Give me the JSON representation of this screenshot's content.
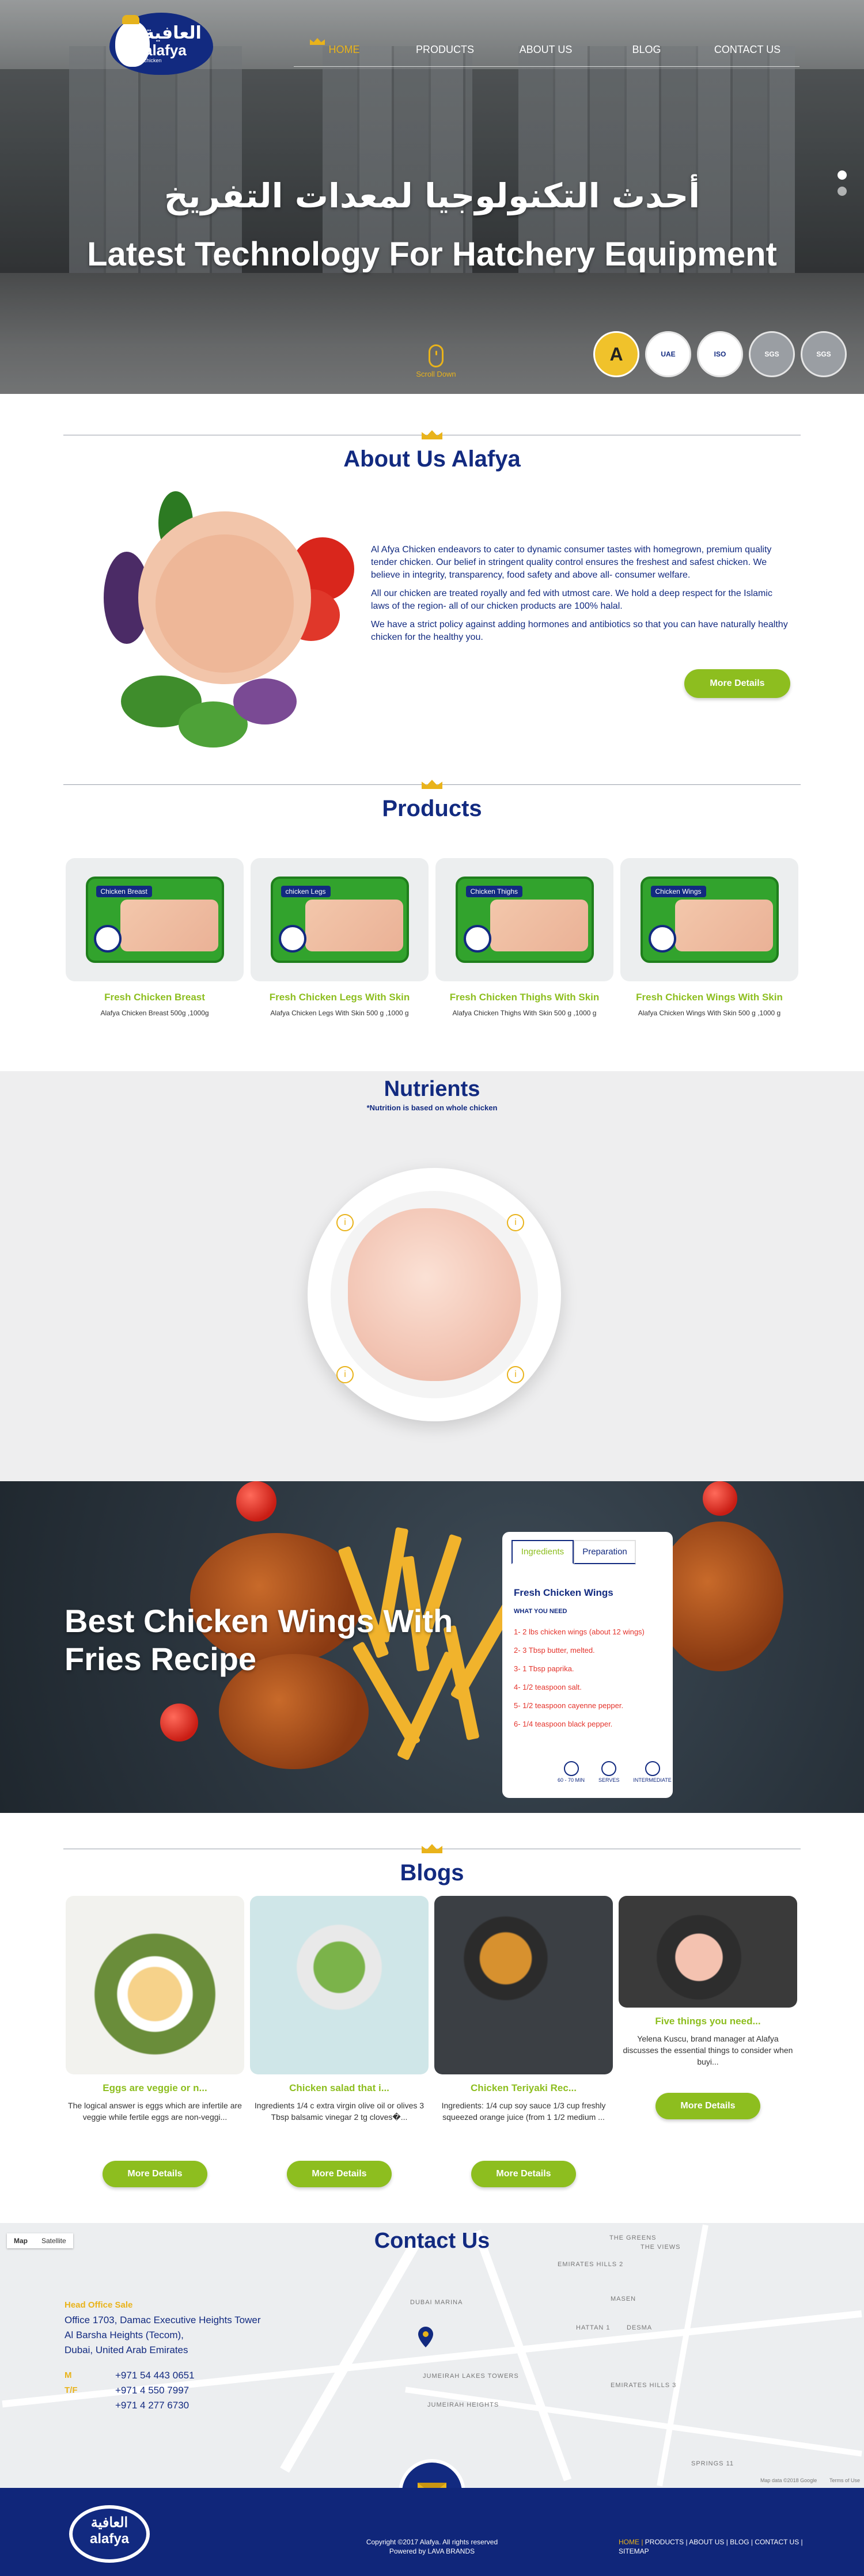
{
  "brand": {
    "arabic": "العافية",
    "name": "alafya",
    "sub": "chicken"
  },
  "nav": {
    "items": [
      "HOME",
      "PRODUCTS",
      "ABOUT US",
      "BLOG",
      "CONTACT US"
    ]
  },
  "hero": {
    "title_ar": "أحدث التكنولوجيا لمعدات التفريخ",
    "title_en": "Latest Technology For Hatchery Equipment",
    "scroll_label": "Scroll Down",
    "badges": [
      "A",
      "UAE",
      "ISO",
      "SGS",
      "SGS"
    ]
  },
  "about": {
    "heading": "About Us Alafya",
    "p1": "Al Afya Chicken endeavors to cater to dynamic consumer tastes with homegrown, premium quality tender chicken. Our belief in stringent quality control ensures the freshest and safest chicken. We believe in integrity, transparency, food safety and above all- consumer welfare.",
    "p2": "All our chicken are treated royally and fed with utmost care. We hold a deep respect for the Islamic laws of the region- all of our chicken products are 100% halal.",
    "p3": "We have a strict policy against adding hormones and antibiotics so that you can have naturally healthy chicken for the healthy you.",
    "button": "More Details"
  },
  "products": {
    "heading": "Products",
    "items": [
      {
        "pack_label": "Chicken Breast",
        "name": "Fresh Chicken Breast",
        "desc": "Alafya Chicken Breast 500g ,1000g"
      },
      {
        "pack_label": "chicken Legs",
        "name": "Fresh Chicken Legs With Skin",
        "desc": "Alafya Chicken Legs With Skin 500 g ,1000 g"
      },
      {
        "pack_label": "Chicken Thighs",
        "name": "Fresh Chicken Thighs With Skin",
        "desc": "Alafya Chicken Thighs With Skin 500 g ,1000 g"
      },
      {
        "pack_label": "Chicken Wings",
        "name": "Fresh Chicken Wings With Skin",
        "desc": "Alafya Chicken Wings With Skin 500 g ,1000 g"
      }
    ]
  },
  "nutrients": {
    "heading": "Nutrients",
    "note": "*Nutrition is based on whole chicken",
    "pin": "i"
  },
  "recipe": {
    "title": "Best Chicken Wings With Fries Recipe",
    "tabs": [
      "Ingredients",
      "Preparation"
    ],
    "card_title": "Fresh Chicken Wings",
    "card_sub": "WHAT YOU NEED",
    "ingredients": [
      "1-  2 lbs chicken wings (about 12 wings)",
      "2-  3 Tbsp butter, melted.",
      "3-  1 Tbsp paprika.",
      "4-  1/2 teaspoon salt.",
      "5-  1/2 teaspoon cayenne pepper.",
      "6-  1/4 teaspoon black pepper."
    ],
    "icons": [
      "60 - 70 MIN",
      "SERVES",
      "INTERMEDIATE"
    ]
  },
  "blogs": {
    "heading": "Blogs",
    "items": [
      {
        "title": "Eggs are veggie or n...",
        "desc": "The logical answer is eggs which are infertile are veggie while fertile eggs are non-veggi...",
        "button": "More Details"
      },
      {
        "title": "Chicken salad that i...",
        "desc": "Ingredients 1/4 c extra virgin olive oil or olives 3 Tbsp balsamic vinegar 2 tg cloves�...",
        "button": "More Details"
      },
      {
        "title": "Chicken Teriyaki Rec...",
        "desc": "Ingredients: 1/4 cup soy sauce 1/3 cup freshly squeezed orange juice (from 1 1/2 medium ...",
        "button": "More Details"
      },
      {
        "title": "Five things you need...",
        "desc": "Yelena Kuscu, brand manager at Alafya discusses the essential things to consider when buyi...",
        "button": "More Details"
      }
    ]
  },
  "contact": {
    "heading": "Contact Us",
    "map_tabs": [
      "Map",
      "Satellite"
    ],
    "office_label": "Head Office Sale",
    "address": [
      "Office 1703, Damac Executive Heights Tower",
      "Al Barsha Heights (Tecom),",
      "Dubai, United Arab Emirates"
    ],
    "phone_labels": [
      "M",
      "T/F"
    ],
    "phones": [
      "+971 54 443 0651",
      "+971 4 550 7997",
      "+971 4 277 6730"
    ],
    "map_labels": [
      "THE GREENS",
      "THE VIEWS",
      "EMIRATES HILLS 2",
      "DUBAI MARINA",
      "MASEN",
      "HATTAN 1",
      "DESMA",
      "JUMEIRAH LAKES TOWERS",
      "JUMEIRAH HEIGHTS",
      "EMIRATES HILLS 3",
      "SPRINGS 11",
      "Map data ©2018 Google",
      "Terms of Use"
    ]
  },
  "footer": {
    "copyright": "Copyright ©2017 Alafya. All rights reserved",
    "powered": "Powered by LAVA BRANDS",
    "links": [
      "HOME |",
      "PRODUCTS |",
      "ABOUT US |",
      "BLOG |",
      "CONTACT US |",
      "SITEMAP"
    ]
  },
  "colors": {
    "navy": "#122a80",
    "green": "#8dbe1f",
    "gold": "#e9b31b",
    "red": "#e4332b"
  }
}
